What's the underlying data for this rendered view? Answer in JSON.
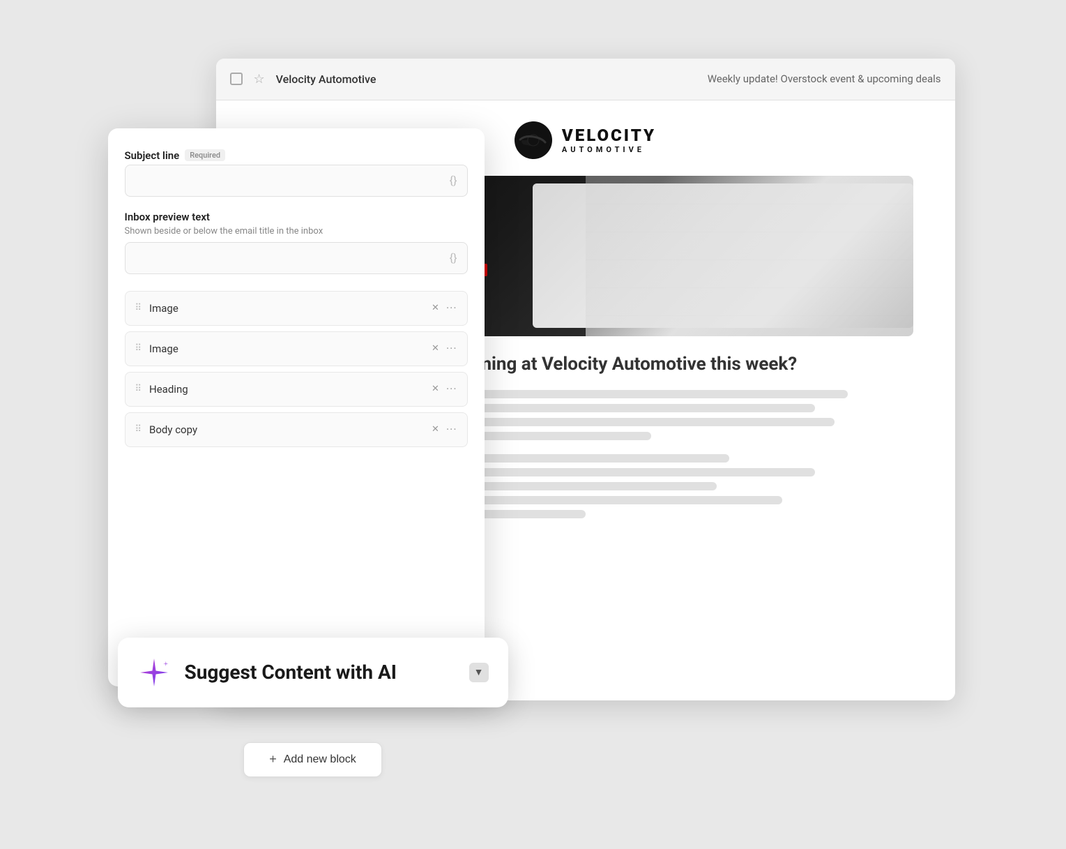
{
  "emailWindow": {
    "sender": "Velocity Automotive",
    "subjectPreview": "Weekly update! Overstock event & upcoming deals"
  },
  "brand": {
    "name": "VELOCITY",
    "sub": "AUTOMOTIVE"
  },
  "emailContent": {
    "heading": "What's happening at Velocity Automotive this week?",
    "skeletonLines": [
      {
        "width": "90%"
      },
      {
        "width": "85%"
      },
      {
        "width": "88%"
      },
      {
        "width": "60%"
      },
      {
        "width": "72%"
      },
      {
        "width": "85%"
      },
      {
        "width": "70%"
      },
      {
        "width": "80%"
      },
      {
        "width": "50%"
      }
    ]
  },
  "editorPanel": {
    "subjectLine": {
      "label": "Subject line",
      "requiredBadge": "Required",
      "placeholder": ""
    },
    "inboxPreview": {
      "label": "Inbox preview text",
      "sublabel": "Shown beside or below the email title in the inbox",
      "placeholder": ""
    },
    "blocks": [
      {
        "label": "Image"
      },
      {
        "label": "Image"
      },
      {
        "label": "Heading"
      },
      {
        "label": "Body copy"
      }
    ]
  },
  "aiButton": {
    "label": "Suggest Content with AI",
    "iconLabel": "ai-sparkle-icon",
    "chevronLabel": "▼"
  },
  "addBlock": {
    "label": "Add new block",
    "plusIcon": "+"
  }
}
